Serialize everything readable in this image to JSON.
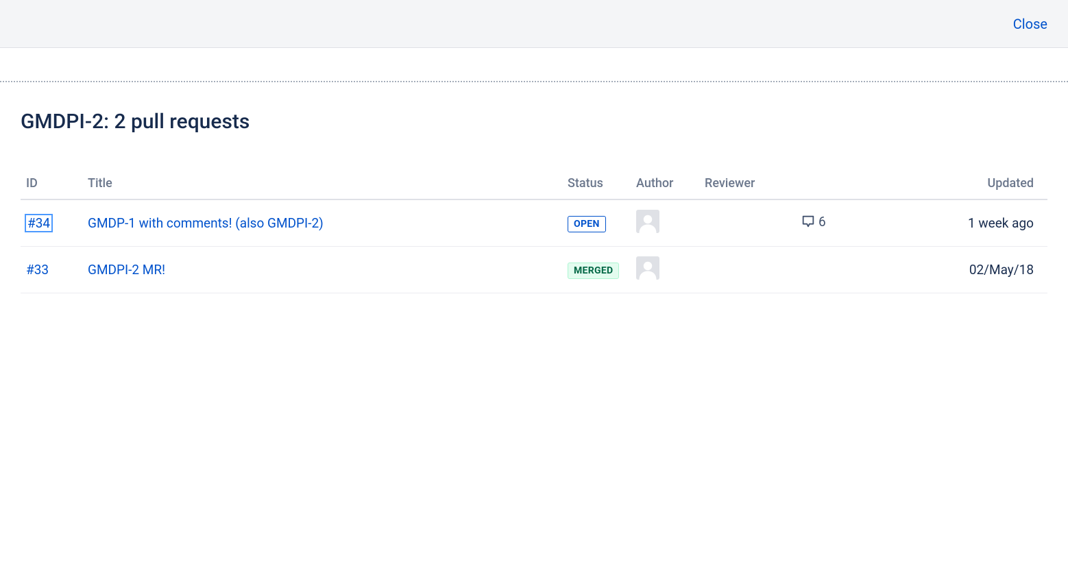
{
  "header": {
    "close_label": "Close"
  },
  "page": {
    "title": "GMDPI-2: 2 pull requests"
  },
  "table": {
    "headers": {
      "id": "ID",
      "title": "Title",
      "status": "Status",
      "author": "Author",
      "reviewer": "Reviewer",
      "updated": "Updated"
    },
    "rows": [
      {
        "id": "#34",
        "title": "GMDP-1 with comments! (also GMDPI-2)",
        "status": "OPEN",
        "status_class": "status-open",
        "comment_count": "6",
        "has_comments": true,
        "updated": "1 week ago",
        "focused": true
      },
      {
        "id": "#33",
        "title": "GMDPI-2 MR!",
        "status": "MERGED",
        "status_class": "status-merged",
        "comment_count": "",
        "has_comments": false,
        "updated": "02/May/18",
        "focused": false
      }
    ]
  }
}
